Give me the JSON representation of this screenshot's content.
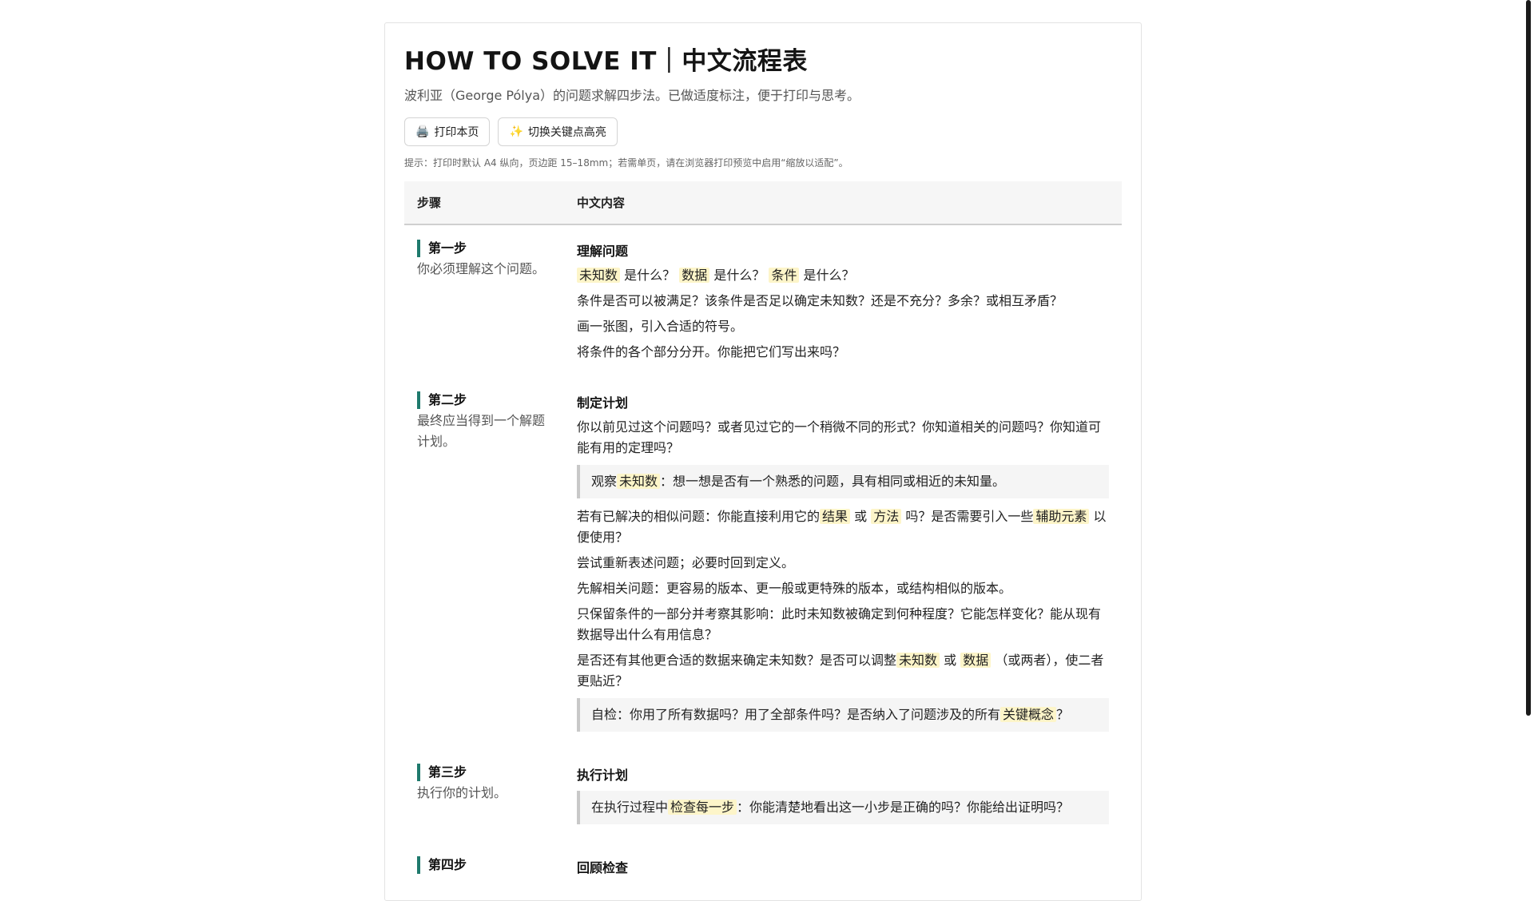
{
  "header": {
    "title": "HOW TO SOLVE IT｜中文流程表",
    "subtitle": "波利亚（George Pólya）的问题求解四步法。已做适度标注，便于打印与思考。",
    "hint": "提示：打印时默认 A4 纵向，页边距 15–18mm；若需单页，请在浏览器打印预览中启用“缩放以适配”。"
  },
  "buttons": {
    "print": {
      "icon": "🖨️",
      "label": "打印本页"
    },
    "toggle": {
      "icon": "✨",
      "label": "切换关键点高亮"
    }
  },
  "table": {
    "col_step": "步骤",
    "col_content": "中文内容"
  },
  "steps": [
    {
      "label": "第一步",
      "desc": "你必须理解这个问题。",
      "heading": "理解问题",
      "p1": {
        "h1": "未知数",
        "t1": "是什么？",
        "h2": "数据",
        "t2": "是什么？",
        "h3": "条件",
        "t3": "是什么？"
      },
      "p2": "条件是否可以被满足？该条件是否足以确定未知数？还是不充分？多余？或相互矛盾？",
      "p3": "画一张图，引入合适的符号。",
      "p4": "将条件的各个部分分开。你能把它们写出来吗？"
    },
    {
      "label": "第二步",
      "desc": "最终应当得到一个解题计划。",
      "heading": "制定计划",
      "p1": "你以前见过这个问题吗？或者见过它的一个稍微不同的形式？你知道相关的问题吗？你知道可能有用的定理吗？",
      "c1": {
        "t0": "观察",
        "h1": "未知数",
        "t1": "：想一想是否有一个熟悉的问题，具有相同或相近的未知量。"
      },
      "p2": {
        "t0": "若有已解决的相似问题：你能直接利用它的",
        "h1": "结果",
        "t1": "或",
        "h2": "方法",
        "t2": "吗？是否需要引入一些",
        "h3": "辅助元素",
        "t3": "以便使用？"
      },
      "p3": "尝试重新表述问题；必要时回到定义。",
      "p4": "先解相关问题：更容易的版本、更一般或更特殊的版本，或结构相似的版本。",
      "p5": "只保留条件的一部分并考察其影响：此时未知数被确定到何种程度？它能怎样变化？能从现有数据导出什么有用信息？",
      "p6": {
        "t0": "是否还有其他更合适的数据来确定未知数？是否可以调整",
        "h1": "未知数",
        "t1": "或",
        "h2": "数据",
        "t2": "（或两者），使二者更贴近？"
      },
      "c2": {
        "t0": "自检：你用了所有数据吗？用了全部条件吗？是否纳入了问题涉及的所有",
        "h1": "关键概念",
        "t1": "？"
      }
    },
    {
      "label": "第三步",
      "desc": "执行你的计划。",
      "heading": "执行计划",
      "c1": {
        "t0": "在执行过程中",
        "h1": "检查每一步",
        "t1": "：你能清楚地看出这一小步是正确的吗？你能给出证明吗？"
      }
    },
    {
      "label": "第四步",
      "heading": "回顾检查"
    }
  ]
}
